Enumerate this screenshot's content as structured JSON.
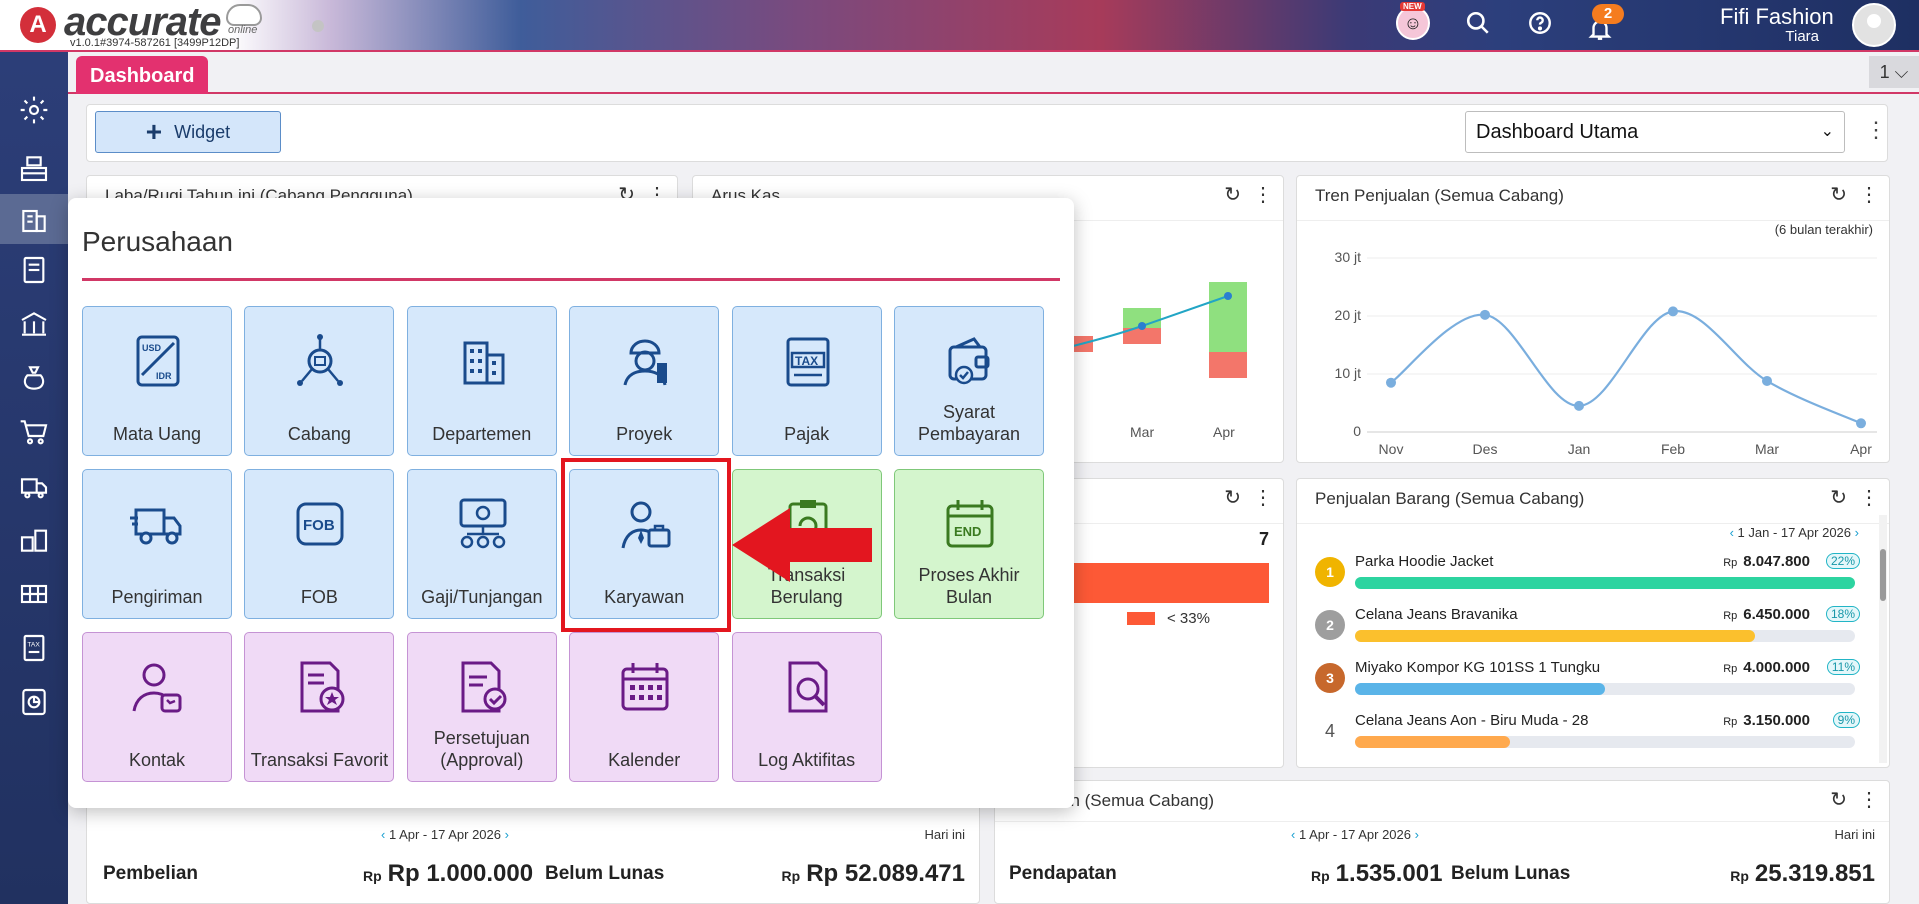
{
  "topbar": {
    "logo": "accurate",
    "logo_sub": "online",
    "version": "v1.0.1#3974-587261 [3499P12DP]",
    "new_badge": "NEW",
    "notif_count": "2",
    "company": "Fifi Fashion",
    "user": "Tiara"
  },
  "tabs": {
    "dashboard": "Dashboard",
    "page_number": "1 ⌵"
  },
  "widgetbar": {
    "widget_label": "Widget",
    "dashboard_select": "Dashboard Utama"
  },
  "panels": {
    "laba_rugi": "Laba/Rugi Tahun ini (Cabang Pengguna)",
    "arus_kas": "Arus Kas",
    "arus_kas_months": [
      "Mar",
      "Apr"
    ],
    "tren": {
      "title": "Tren Penjualan (Semua Cabang)",
      "subtitle": "(6 bulan terakhir)"
    },
    "mid_value": "7",
    "mid_legend": "< 33%",
    "penjualan_barang": {
      "title": "Penjualan Barang (Semua Cabang)",
      "date_range": "1 Jan - 17 Apr 2026",
      "rp": "Rp",
      "items": [
        {
          "rank": "1",
          "name": "Parka Hoodie Jacket",
          "amount": "8.047.800",
          "pct": "22%",
          "fill": 1.0,
          "color": "#2dd4a0"
        },
        {
          "rank": "2",
          "name": "Celana Jeans Bravanika",
          "amount": "6.450.000",
          "pct": "18%",
          "fill": 0.8,
          "color": "#fbc02d"
        },
        {
          "rank": "3",
          "name": "Miyako Kompor KG 101SS 1 Tungku",
          "amount": "4.000.000",
          "pct": "11%",
          "fill": 0.5,
          "color": "#5ab4e8"
        },
        {
          "rank": "4",
          "name": "Celana Jeans Aon - Biru Muda - 28",
          "amount": "3.150.000",
          "pct": "9%",
          "fill": 0.31,
          "color": "#ffa94d"
        }
      ]
    },
    "pembelian": {
      "date_range": "1 Apr - 17 Apr 2026",
      "hari_ini": "Hari ini",
      "label": "Pembelian",
      "rp_small": "Rp",
      "value": "Rp 1.000.000",
      "belum_lunas": "Belum Lunas",
      "belum_value": "Rp 52.089.471"
    },
    "pendapatan": {
      "title": "an (Semua Cabang)",
      "date_range": "1 Apr - 17 Apr 2026",
      "hari_ini": "Hari ini",
      "label": "Pendapatan",
      "rp_small": "Rp",
      "value": "1.535.001",
      "belum_lunas": "Belum Lunas",
      "belum_value": "25.319.851"
    }
  },
  "chart_data": {
    "type": "line",
    "categories": [
      "Nov",
      "Des",
      "Jan",
      "Feb",
      "Mar",
      "Apr"
    ],
    "y_tick_labels": [
      "30 jt",
      "20 jt",
      "10 jt",
      "0"
    ],
    "y_ticks": [
      30,
      20,
      10,
      0
    ],
    "ylim": [
      0,
      30
    ],
    "values": [
      8.5,
      20.2,
      4.5,
      20.8,
      8.8,
      1.5
    ],
    "color": "#7aaede",
    "grid": true
  },
  "overlay": {
    "title": "Perusahaan",
    "tiles": [
      {
        "label": "Mata Uang",
        "icon": "currency-exchange-icon"
      },
      {
        "label": "Cabang",
        "icon": "branch-network-icon"
      },
      {
        "label": "Departemen",
        "icon": "building-icon"
      },
      {
        "label": "Proyek",
        "icon": "worker-icon"
      },
      {
        "label": "Pajak",
        "icon": "tax-icon"
      },
      {
        "label": "Syarat Pembayaran",
        "icon": "wallet-icon"
      },
      {
        "label": "Pengiriman",
        "icon": "truck-icon"
      },
      {
        "label": "FOB",
        "icon": "fob-icon"
      },
      {
        "label": "Gaji/Tunjangan",
        "icon": "salary-icon"
      },
      {
        "label": "Karyawan",
        "icon": "employee-icon"
      },
      {
        "label": "Transaksi Berulang",
        "icon": "recurring-icon"
      },
      {
        "label": "Proses Akhir Bulan",
        "icon": "calendar-end-icon"
      },
      {
        "label": "Kontak",
        "icon": "contact-icon"
      },
      {
        "label": "Transaksi Favorit",
        "icon": "favorite-icon"
      },
      {
        "label": "Persetujuan (Approval)",
        "icon": "approval-icon"
      },
      {
        "label": "Kalender",
        "icon": "calendar-icon"
      },
      {
        "label": "Log Aktifitas",
        "icon": "log-search-icon"
      }
    ]
  },
  "colors": {
    "accent": "#e3316f",
    "sidebar": "#2c3e78",
    "highlight": "#e3161f"
  }
}
